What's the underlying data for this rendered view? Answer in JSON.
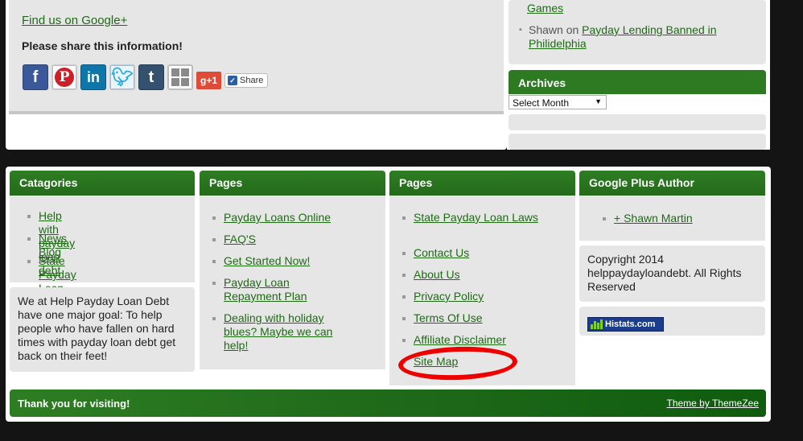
{
  "share": {
    "find_us": "Find us on Google+",
    "title": "Please share this information!",
    "gplus_label": "g+1",
    "share_label": "Share"
  },
  "recent_comments": {
    "prev_link_tail": "Games",
    "author": "Shawn",
    "on_word": "on",
    "post_link": "Payday Lending Banned in Philidelphia"
  },
  "archives": {
    "title": "Archives",
    "select_value": "Select Month"
  },
  "footer": {
    "categories": {
      "title": "Catagories",
      "items": [
        "Help with payday loan debt",
        "News Blog",
        "State Payday Loan Laws"
      ]
    },
    "about": "We at Help Payday Loan Debt have one major goal: To help people who have fallen on hard times with payday loan debt get back on their feet!",
    "pages1": {
      "title": "Pages",
      "items": [
        "Payday Loans Online",
        "FAQ'S",
        "Get Started Now!",
        "Payday Loan Repayment Plan",
        "Dealing with holiday blues? Maybe we can help!"
      ]
    },
    "pages2": {
      "title": "Pages",
      "items": [
        "State Payday Loan Laws",
        "Contact Us",
        "About Us",
        "Privacy Policy",
        "Terms Of Use",
        "Affiliate Disclaimer",
        "Site Map"
      ]
    },
    "author": {
      "title": "Google Plus Author",
      "link": "+ Shawn Martin"
    },
    "copyright": "Copyright 2014 helppaydayloandebt. All Rights Reserved",
    "histats_label": "Histats.com",
    "thanks": "Thank you for visiting!",
    "theme_credit": "Theme by ThemeZee"
  },
  "colors": {
    "green": "#2d7a23",
    "link": "#1e6b14",
    "highlight_red": "#ee0000"
  }
}
